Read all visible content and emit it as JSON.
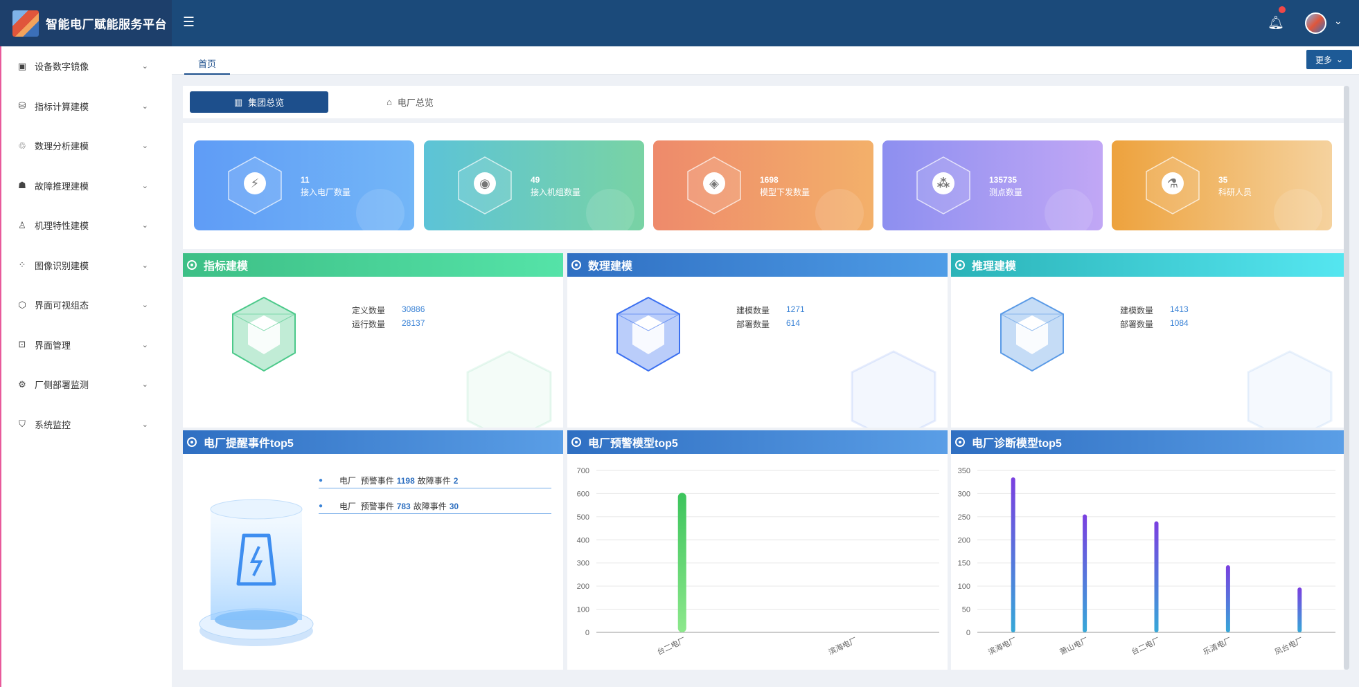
{
  "header": {
    "brand_title": "智能电厂赋能服务平台",
    "menu_icon": "menu-fold-icon",
    "bell_icon": "bell-icon"
  },
  "sidebar": {
    "items": [
      {
        "label": "设备数字镜像",
        "icon": "▣"
      },
      {
        "label": "指标计算建模",
        "icon": "⛁"
      },
      {
        "label": "数理分析建模",
        "icon": "♲"
      },
      {
        "label": "故障推理建模",
        "icon": "☗"
      },
      {
        "label": "机理特性建模",
        "icon": "♙"
      },
      {
        "label": "图像识别建模",
        "icon": "⁘"
      },
      {
        "label": "界面可视组态",
        "icon": "⬡"
      },
      {
        "label": "界面管理",
        "icon": "⊡"
      },
      {
        "label": "厂侧部署监测",
        "icon": "⚙"
      },
      {
        "label": "系统监控",
        "icon": "⛉"
      }
    ]
  },
  "tabs": {
    "home_label": "首页",
    "more_label": "更多"
  },
  "segments": {
    "active_label": "集团总览",
    "inactive_label": "电厂总览"
  },
  "stats": [
    {
      "value": "11",
      "label": "接入电厂数量",
      "color_from": "#5f9cf6",
      "color_to": "#73b6f7",
      "icon": "⚡"
    },
    {
      "value": "49",
      "label": "接入机组数量",
      "color_from": "#5cc3d7",
      "color_to": "#79d3a4",
      "icon": "◉"
    },
    {
      "value": "1698",
      "label": "模型下发数量",
      "color_from": "#ee8a6b",
      "color_to": "#f3b06a",
      "icon": "◈"
    },
    {
      "value": "135735",
      "label": "测点数量",
      "color_from": "#8d8ff0",
      "color_to": "#c1a7f5",
      "icon": "⁂"
    },
    {
      "value": "35",
      "label": "科研人员",
      "color_from": "#eda23d",
      "color_to": "#f5d29e",
      "icon": "⚗"
    }
  ],
  "models": [
    {
      "title": "指标建模",
      "head_from": "#3dbf86",
      "head_to": "#55e3a8",
      "rows": [
        {
          "label": "定义数量",
          "value": "30886"
        },
        {
          "label": "运行数量",
          "value": "28137"
        }
      ],
      "cube_color": "#4cc98a"
    },
    {
      "title": "数理建模",
      "head_from": "#2f6fc2",
      "head_to": "#4e9ce6",
      "rows": [
        {
          "label": "建模数量",
          "value": "1271"
        },
        {
          "label": "部署数量",
          "value": "614"
        }
      ],
      "cube_color": "#3a6ff0"
    },
    {
      "title": "推理建模",
      "head_from": "#2bb3b8",
      "head_to": "#55e6f0",
      "rows": [
        {
          "label": "建模数量",
          "value": "1413"
        },
        {
          "label": "部署数量",
          "value": "1084"
        }
      ],
      "cube_color": "#5a9ae6"
    }
  ],
  "events": {
    "title": "电厂提醒事件top5",
    "rows": [
      {
        "prefix": "电厂",
        "warn_label": "预警事件",
        "warn_value": "1198",
        "fault_label": "故障事件",
        "fault_value": "2"
      },
      {
        "prefix": "电厂",
        "warn_label": "预警事件",
        "warn_value": "783",
        "fault_label": "故障事件",
        "fault_value": "30"
      }
    ]
  },
  "chart_data": [
    {
      "type": "bar",
      "title": "电厂预警模型top5",
      "categories": [
        "台二电厂",
        "滨海电厂"
      ],
      "values": [
        603,
        0
      ],
      "ylim": [
        0,
        700
      ],
      "yticks": [
        0,
        100,
        200,
        300,
        400,
        500,
        600,
        700
      ],
      "grid": true,
      "bar_color_top": "#3cc45c",
      "bar_color_bottom": "#8de88c"
    },
    {
      "type": "bar",
      "title": "电厂诊断模型top5",
      "categories": [
        "滨海电厂",
        "萧山电厂",
        "台二电厂",
        "乐清电厂",
        "凤台电厂"
      ],
      "values": [
        335,
        255,
        240,
        145,
        97
      ],
      "ylim": [
        0,
        350
      ],
      "yticks": [
        0,
        50,
        100,
        150,
        200,
        250,
        300,
        350
      ],
      "grid": true,
      "bar_color_top": "#7a3fe0",
      "bar_color_bottom": "#36a8d8"
    }
  ]
}
